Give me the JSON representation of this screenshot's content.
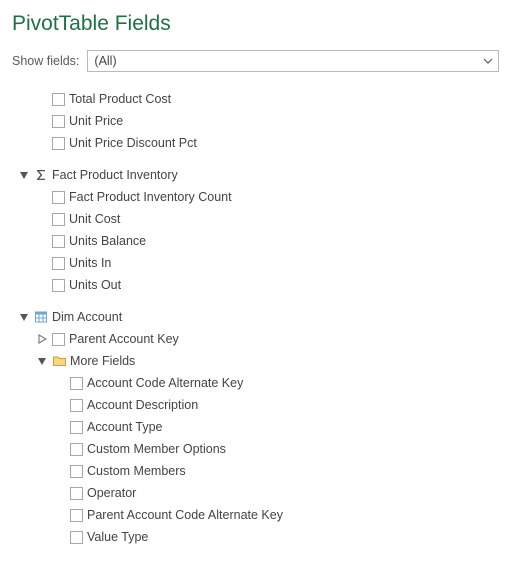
{
  "title": "PivotTable Fields",
  "filter": {
    "label": "Show fields:",
    "value": "(All)"
  },
  "groups": [
    {
      "orphanFields": [
        "Total Product Cost",
        "Unit Price",
        "Unit Price Discount Pct"
      ]
    },
    {
      "name": "Fact Product Inventory",
      "icon": "sigma",
      "expanded": true,
      "fields": [
        "Fact Product Inventory Count",
        "Unit Cost",
        "Units Balance",
        "Units In",
        "Units Out"
      ]
    },
    {
      "name": "Dim Account",
      "icon": "table",
      "expanded": true,
      "children": [
        {
          "name": "Parent Account Key",
          "expandable": true,
          "expanded": false,
          "checkbox": true
        },
        {
          "name": "More Fields",
          "icon": "folder",
          "expandable": true,
          "expanded": true,
          "fields": [
            "Account Code Alternate Key",
            "Account Description",
            "Account Type",
            "Custom Member Options",
            "Custom Members",
            "Operator",
            "Parent Account Code Alternate Key",
            "Value Type"
          ]
        }
      ]
    }
  ]
}
